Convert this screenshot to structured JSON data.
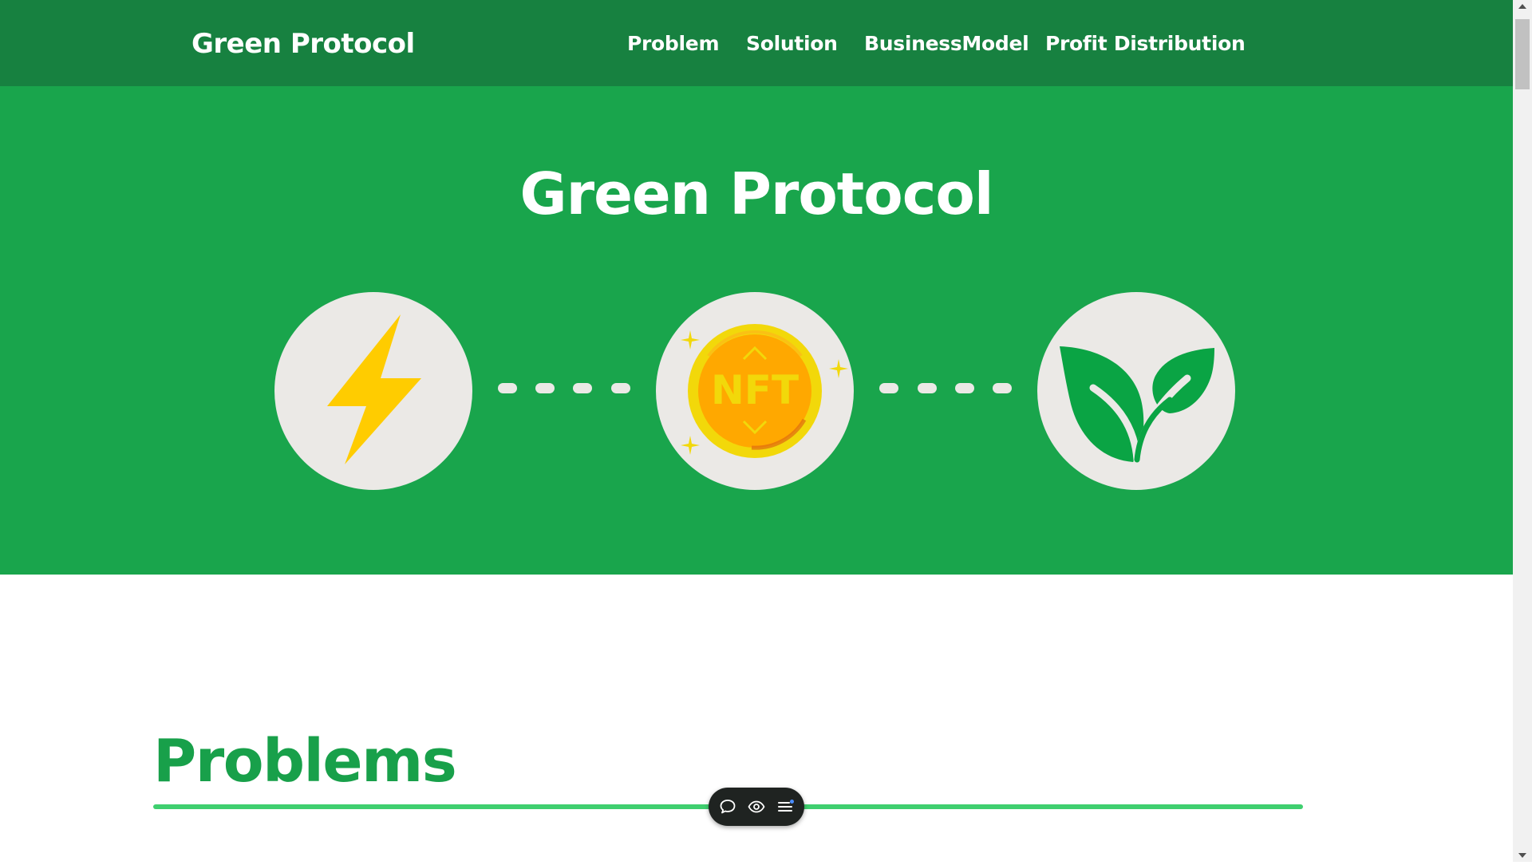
{
  "nav": {
    "brand": "Green Protocol",
    "links": [
      "Problem",
      "Solution",
      "BusinessModel",
      "Profit Distribution"
    ]
  },
  "hero": {
    "title": "Green Protocol",
    "icons": [
      "lightning-bolt-icon",
      "nft-coin-icon",
      "leaf-icon"
    ],
    "nft_label": "NFT"
  },
  "section": {
    "title": "Problems"
  },
  "toolbar": {
    "icons": [
      "chat-bubble-icon",
      "eye-icon",
      "menu-icon"
    ]
  },
  "colors": {
    "nav_bg": "#178140",
    "hero_bg": "#19a54c",
    "accent_green": "#18a04a",
    "divider": "#3fcf6f",
    "bolt": "#ffcc00",
    "coin": "#ffa800"
  }
}
